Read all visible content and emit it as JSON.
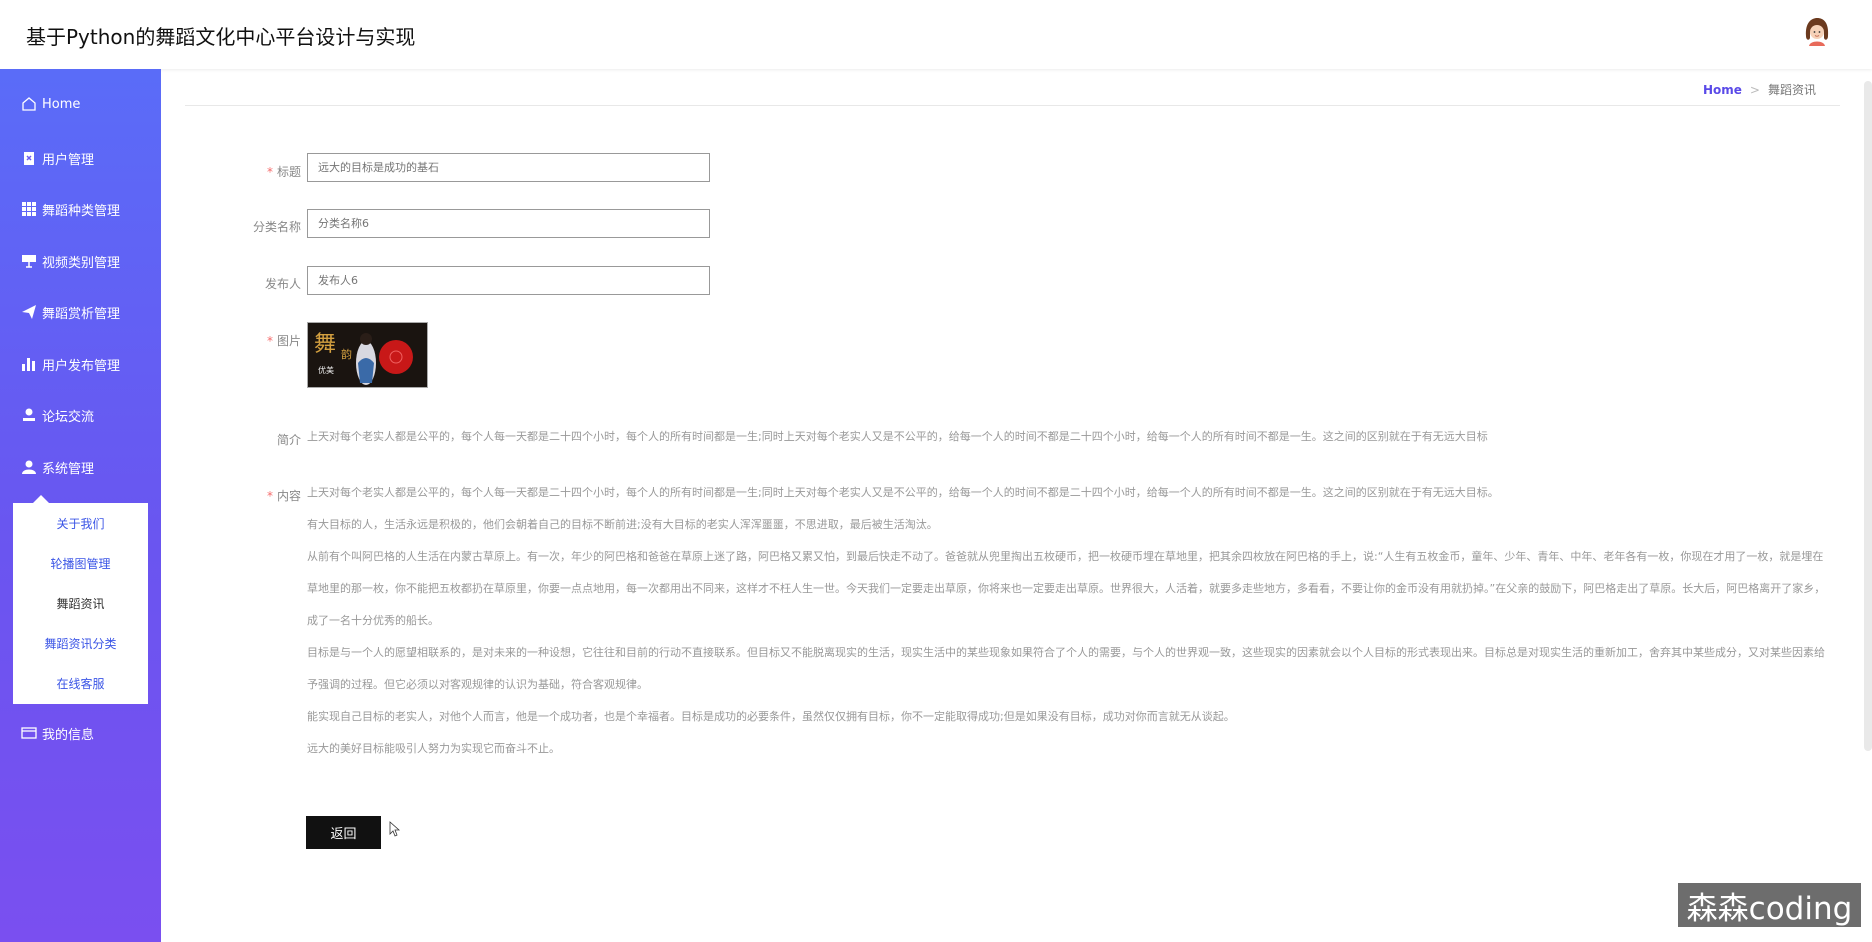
{
  "app": {
    "title": "基于Python的舞蹈文化中心平台设计与实现"
  },
  "sidebar": {
    "items": [
      {
        "label": "Home",
        "icon": "home-icon"
      },
      {
        "label": "用户管理",
        "icon": "clipboard-icon"
      },
      {
        "label": "舞蹈种类管理",
        "icon": "grid-icon"
      },
      {
        "label": "视频类别管理",
        "icon": "projector-icon"
      },
      {
        "label": "舞蹈赏析管理",
        "icon": "send-icon"
      },
      {
        "label": "用户发布管理",
        "icon": "bar-chart-icon"
      },
      {
        "label": "论坛交流",
        "icon": "user-upload-icon"
      },
      {
        "label": "系统管理",
        "icon": "person-icon"
      },
      {
        "label": "我的信息",
        "icon": "card-icon"
      }
    ],
    "submenu": [
      "关于我们",
      "轮播图管理",
      "舞蹈资讯",
      "舞蹈资讯分类",
      "在线客服"
    ],
    "submenu_active": 2
  },
  "breadcrumb": {
    "home": "Home",
    "separator": ">",
    "current": "舞蹈资讯"
  },
  "form": {
    "title": {
      "label": "标题",
      "placeholder": "远大的目标是成功的基石"
    },
    "category": {
      "label": "分类名称",
      "placeholder": "分类名称6"
    },
    "publisher": {
      "label": "发布人",
      "placeholder": "发布人6"
    },
    "image": {
      "label": "图片",
      "text_main": "舞",
      "text_sub": "韵",
      "text_small": "优美"
    },
    "intro": {
      "label": "简介",
      "text": "上天对每个老实人都是公平的，每个人每一天都是二十四个小时，每个人的所有时间都是一生;同时上天对每个老实人又是不公平的，给每一个人的时间不都是二十四个小时，给每一个人的所有时间不都是一生。这之间的区别就在于有无远大目标"
    },
    "content": {
      "label": "内容",
      "paragraphs": [
        "上天对每个老实人都是公平的，每个人每一天都是二十四个小时，每个人的所有时间都是一生;同时上天对每个老实人又是不公平的，给每一个人的时间不都是二十四个小时，给每一个人的所有时间不都是一生。这之间的区别就在于有无远大目标。",
        "有大目标的人，生活永远是积极的，他们会朝着自己的目标不断前进;没有大目标的老实人浑浑噩噩，不思进取，最后被生活淘汰。",
        "从前有个叫阿巴格的人生活在内蒙古草原上。有一次，年少的阿巴格和爸爸在草原上迷了路，阿巴格又累又怕，到最后快走不动了。爸爸就从兜里掏出五枚硬币，把一枚硬币埋在草地里，把其余四枚放在阿巴格的手上，说:“人生有五枚金币，童年、少年、青年、中年、老年各有一枚，你现在才用了一枚，就是埋在草地里的那一枚，你不能把五枚都扔在草原里，你要一点点地用，每一次都用出不同来，这样才不枉人生一世。今天我们一定要走出草原，你将来也一定要走出草原。世界很大，人活着，就要多走些地方，多看看，不要让你的金币没有用就扔掉。”在父亲的鼓励下，阿巴格走出了草原。长大后，阿巴格离开了家乡，成了一名十分优秀的船长。",
        "目标是与一个人的愿望相联系的，是对未来的一种设想，它往往和目前的行动不直接联系。但目标又不能脱离现实的生活，现实生活中的某些现象如果符合了个人的需要，与个人的世界观一致，这些现实的因素就会以个人目标的形式表现出来。目标总是对现实生活的重新加工，舍弃其中某些成分，又对某些因素给予强调的过程。但它必须以对客观规律的认识为基础，符合客观规律。",
        "能实现自己目标的老实人，对他个人而言，他是一个成功者，也是个幸福者。目标是成功的必要条件，虽然仅仅拥有目标，你不一定能取得成功;但是如果没有目标，成功对你而言就无从谈起。",
        "远大的美好目标能吸引人努力为实现它而奋斗不止。"
      ]
    }
  },
  "actions": {
    "back": "返回"
  },
  "watermark": "森森coding",
  "colors": {
    "accent": "#5a4ae8",
    "sidebar_top": "#5a6cf8",
    "sidebar_bottom": "#7a4ff0",
    "required": "#f56c6c"
  }
}
